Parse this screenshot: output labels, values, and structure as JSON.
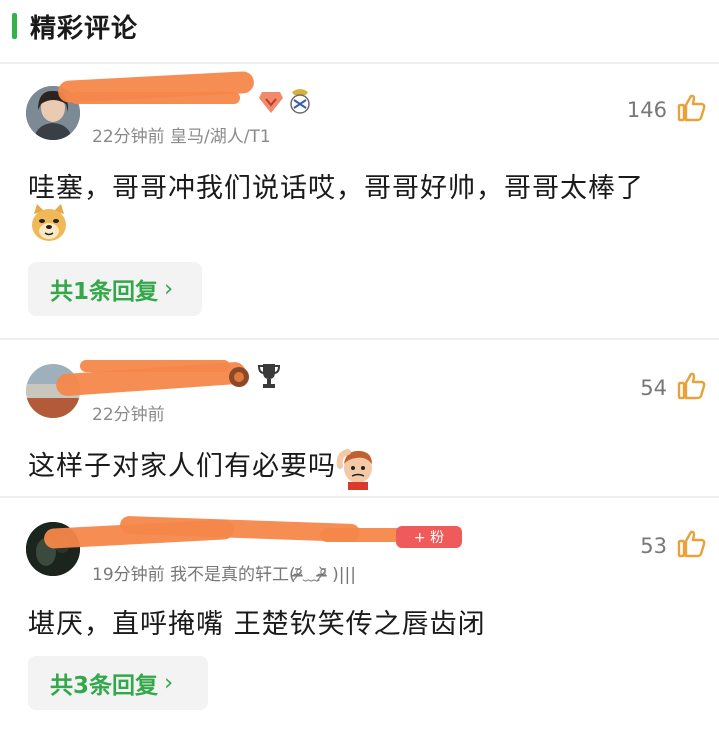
{
  "header": {
    "title": "精彩评论"
  },
  "colors": {
    "accent": "#36b24a",
    "reply_text": "#32a84a",
    "redaction": "#f5874a"
  },
  "comments": [
    {
      "meta": "22分钟前 皇马/湖人/T1",
      "likes": "146",
      "text": "哇塞，哥哥冲我们说话哎，哥哥好帅，哥哥太棒了",
      "emoji": "doge",
      "reply": {
        "label": "共1条回复"
      }
    },
    {
      "meta": "22分钟前",
      "likes": "54",
      "text": "这样子对家人们有必要吗",
      "emoji": "scratching-head"
    },
    {
      "meta": "19分钟前 我不是真的轩工(ᵒ̴̶̷᷄﹏ᵒ̴̶̷᷅ )|||",
      "likes": "53",
      "text": "堪厌，直呼掩嘴 王楚钦笑传之唇齿闭",
      "badge": "+ 粉",
      "reply": {
        "label": "共3条回复"
      }
    }
  ]
}
